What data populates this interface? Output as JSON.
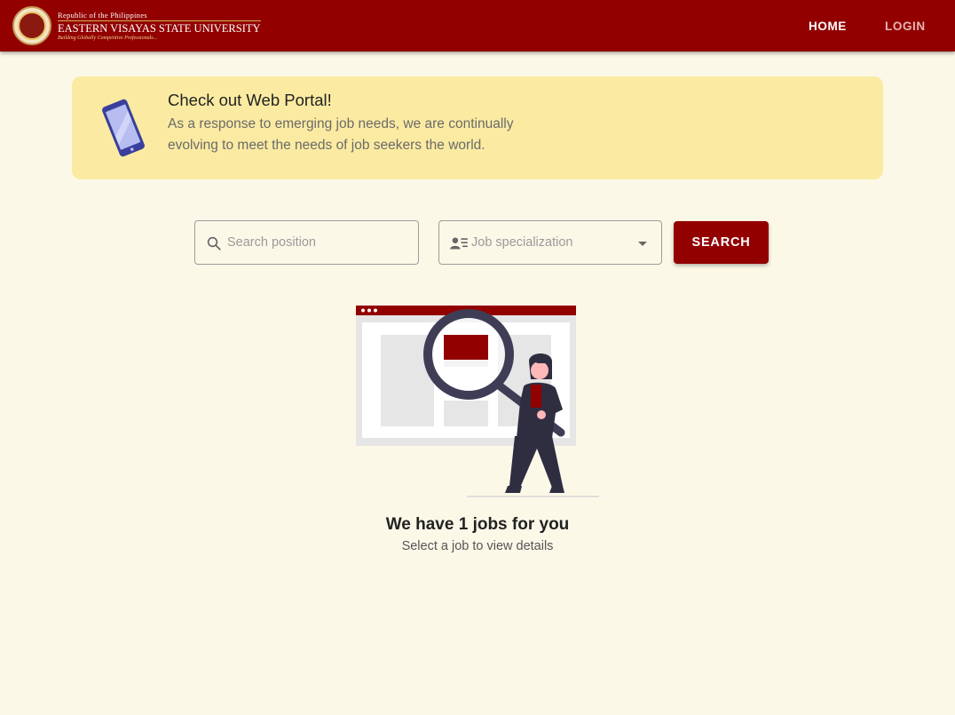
{
  "header": {
    "brand_top": "Republic of the Philippines",
    "brand_name": "EASTERN VISAYAS STATE UNIVERSITY",
    "brand_tagline": "Building Globally Competitive Professionals...",
    "nav": {
      "home": "HOME",
      "login": "LOGIN"
    },
    "colors": {
      "bar": "#920000",
      "accent": "#d8b24a"
    }
  },
  "banner": {
    "title": "Check out Web Portal!",
    "text": "As a response to emerging job needs, we are continually evolving to meet the needs of job seekers the world.",
    "icon": "phone-icon",
    "background": "#fbeba2"
  },
  "search": {
    "position_placeholder": "Search position",
    "position_value": "",
    "specialization_placeholder": "Job specialization",
    "button_label": "SEARCH",
    "icons": {
      "search": "search-icon",
      "specialization": "person-list-icon",
      "dropdown": "chevron-down-icon"
    }
  },
  "results": {
    "title": "We have 1 jobs for you",
    "subtitle": "Select a job to view details",
    "illustration": "magnifier-search-illustration"
  },
  "colors": {
    "page_bg": "#fcf8e8",
    "primary": "#920000"
  }
}
